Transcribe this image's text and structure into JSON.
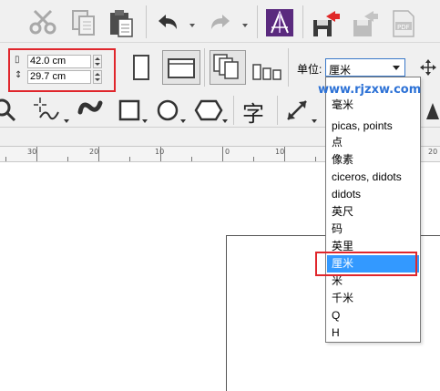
{
  "page_size": {
    "width_value": "42.0 cm",
    "height_value": "29.7 cm"
  },
  "units": {
    "label": "单位:",
    "selected": "厘米",
    "options": [
      "毫米",
      "picas, points",
      "点",
      "像素",
      "ciceros, didots",
      "didots",
      "英尺",
      "码",
      "英里",
      "厘米",
      "米",
      "千米",
      "Q",
      "H"
    ],
    "highlighted_option": "厘米"
  },
  "ruler": {
    "tick_labels": [
      "30",
      "20",
      "10",
      "0",
      "10",
      "20"
    ]
  },
  "watermark": "www.rjzxw.com",
  "text_tool_glyph": "字",
  "highlight_color": "#e0262c",
  "accent_color": "#3399ff"
}
